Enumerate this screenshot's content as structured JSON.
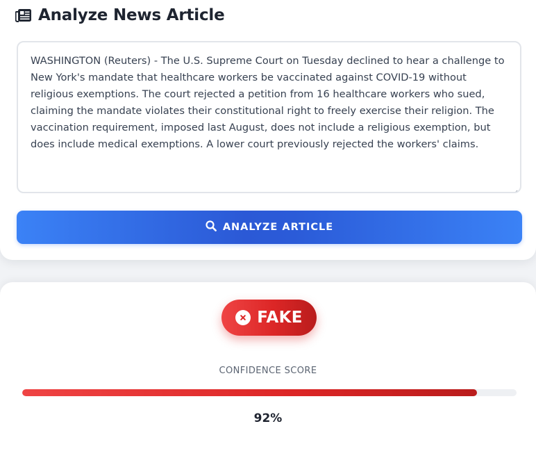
{
  "header": {
    "title": "Analyze News Article",
    "icon": "newspaper-icon"
  },
  "article": {
    "text": "WASHINGTON (Reuters) - The U.S. Supreme Court on Tuesday declined to hear a challenge to New York's mandate that healthcare workers be vaccinated against COVID-19 without religious exemptions. The court rejected a petition from 16 healthcare workers who sued, claiming the mandate violates their constitutional right to freely exercise their religion. The vaccination requirement, imposed last August, does not include a religious exemption, but does include medical exemptions. A lower court previously rejected the workers' claims."
  },
  "analyze_button": {
    "label": "ANALYZE ARTICLE",
    "icon": "search-icon"
  },
  "result": {
    "verdict": "FAKE",
    "verdict_icon": "x-circle-icon",
    "confidence_label": "CONFIDENCE SCORE",
    "confidence_value": "92%",
    "confidence_fraction": 0.92
  },
  "colors": {
    "accent_blue": "#3b82f6",
    "fake_red": "#dc2626"
  }
}
